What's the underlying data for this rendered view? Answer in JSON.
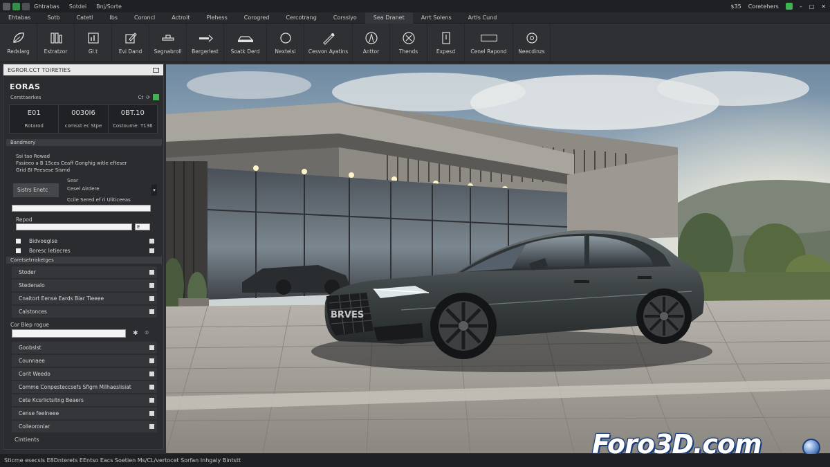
{
  "titlebar": {
    "app_title": "Ghtrabas",
    "menu": [
      "Sotdei",
      "Bnj/Sorte"
    ],
    "right_label": "Coretehers",
    "right_num": "$35"
  },
  "menubar": {
    "items": [
      "Ehtabas",
      "Sotb",
      "Catetl",
      "Ibs",
      "Coroncl",
      "Actroit",
      "Plehess",
      "Corogred",
      "Cercotrang",
      "Corsslyo",
      "Sea Dranet",
      "Arrt Solens",
      "Artls Cund"
    ],
    "selected_index": 10
  },
  "ribbon": {
    "tools": [
      {
        "label": "Redslarg",
        "icon": "leaf-icon"
      },
      {
        "label": "Estratzor",
        "icon": "columns-icon"
      },
      {
        "label": "Gl.t",
        "icon": "chart-icon"
      },
      {
        "label": "Evi Dand",
        "icon": "edit-icon"
      },
      {
        "label": "Segnabroll",
        "icon": "tool-icon"
      },
      {
        "label": "Bergerlest",
        "icon": "arrow-icon"
      },
      {
        "label": "Soatk Derd",
        "icon": "car-icon"
      },
      {
        "label": "Nextelsi",
        "icon": "circle-icon"
      },
      {
        "label": "Cesvon Ayatins",
        "icon": "brush-icon"
      },
      {
        "label": "Anttor",
        "icon": "compass-icon"
      },
      {
        "label": "Thends",
        "icon": "scissors-icon"
      },
      {
        "label": "Expesd",
        "icon": "phone-icon"
      },
      {
        "label": "Cenel Rapond",
        "icon": "rect-icon"
      },
      {
        "label": "Neecdinzs",
        "icon": "pin-icon"
      }
    ]
  },
  "panel": {
    "header": "EGROR.CCT TOIRETIES",
    "brand": "EORAS",
    "brand_sub": "Cersttaerkes",
    "brand_tag": "Ct",
    "stats": [
      {
        "value": "E01",
        "label": "Rotarod"
      },
      {
        "value": "0030I6",
        "label": "comsst ec Stpe"
      },
      {
        "value": "0BT.10",
        "label": "Costoume: T136"
      }
    ],
    "section1": "Bandmery",
    "notes": [
      "Ssi tao Rowad",
      "Fssieeo a B 15ces Ceaff Gonghig witle efteser",
      "Grid BI Peesese Sismd"
    ],
    "option_btn": "Sistrs Enetc",
    "option_title": "Sear",
    "option_line1": "Cesel Airdere",
    "option_line2": "Ccile Sered ef ri Uliticeeas",
    "reped_label": "Repod",
    "reped_value": "E",
    "checks": [
      "Bidvoeglse",
      "Boresc Ietiecres"
    ],
    "section2": "Coretsetrraketges",
    "list1": [
      "Stoder",
      "Stedenalo",
      "Cnaitort Eense       Eards Biar Tieeee",
      "Calstonces"
    ],
    "search_label": "Cor Blep rogue",
    "list2": [
      "Goobslst",
      "Counnaee",
      "Corit Weedo",
      "Comme Conpesteccsefs Sfigm Milhaeslisiat",
      "Cete Kcsrlictsitng Beaers",
      "Cense feelneee",
      "Colleoroniar"
    ],
    "footer": "Cintients"
  },
  "viewport": {
    "plate": "BRVES"
  },
  "watermark": "Foro3D.com",
  "statusbar": "Sticme esecsls   E8Dnterets   EEntso   Eacs Soetien Ms/CL/vertocet   Sorfan   Inhgaly Bintstt"
}
